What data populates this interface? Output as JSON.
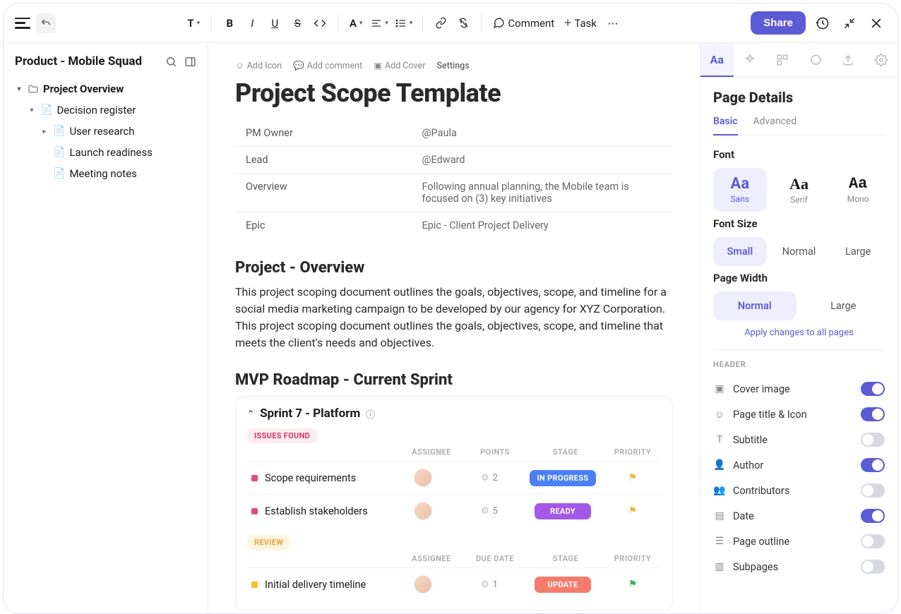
{
  "toolbar": {
    "text_menu": "T",
    "comment": "Comment",
    "task": "Task",
    "share": "Share"
  },
  "sidebar": {
    "title": "Product - Mobile Squad",
    "items": [
      {
        "label": "Project Overview",
        "bold": true
      },
      {
        "label": "Decision register"
      },
      {
        "label": "User research"
      },
      {
        "label": "Launch readiness"
      },
      {
        "label": "Meeting notes"
      }
    ]
  },
  "doc": {
    "meta": {
      "addIcon": "Add Icon",
      "addComment": "Add comment",
      "addCover": "Add Cover",
      "settings": "Settings"
    },
    "title": "Project Scope Template",
    "info": [
      {
        "k": "PM Owner",
        "v": "@Paula"
      },
      {
        "k": "Lead",
        "v": "@Edward"
      },
      {
        "k": "Overview",
        "v": "Following annual planning, the Mobile team is focused on (3) key initiatives"
      },
      {
        "k": "Epic",
        "v": "Epic - Client Project Delivery"
      }
    ],
    "h2a": "Project - Overview",
    "para": "This project scoping document outlines the goals, objectives, scope, and timeline for a social media marketing campaign to be developed by our agency for XYZ Corporation. This project scoping document outlines the goals, objectives, scope, and timeline that meets the client's needs and objectives.",
    "h2b": "MVP Roadmap - Current Sprint",
    "sprint": {
      "title": "Sprint  7 - Platform",
      "group1": {
        "badge": "ISSUES FOUND",
        "cols": [
          "ASSIGNEE",
          "POINTS",
          "STAGE",
          "PRIORITY"
        ],
        "rows": [
          {
            "name": "Scope requirements",
            "points": "2",
            "stage": "IN PROGRESS",
            "stageClass": "blue",
            "flag": "y"
          },
          {
            "name": "Establish stakeholders",
            "points": "5",
            "stage": "READY",
            "stageClass": "purple",
            "flag": "y"
          }
        ]
      },
      "group2": {
        "badge": "REVIEW",
        "cols": [
          "ASSIGNEE",
          "DUE DATE",
          "STAGE",
          "PRIORITY"
        ],
        "rows": [
          {
            "name": "Initial delivery timeline",
            "points": "1",
            "stage": "UPDATE",
            "stageClass": "coral",
            "flag": "g"
          }
        ]
      }
    }
  },
  "panel": {
    "title": "Page Details",
    "subtabs": {
      "basic": "Basic",
      "advanced": "Advanced"
    },
    "font_label": "Font",
    "fonts": [
      {
        "big": "Aa",
        "small": "Sans"
      },
      {
        "big": "Aa",
        "small": "Serif"
      },
      {
        "big": "Aa",
        "small": "Mono"
      }
    ],
    "size_label": "Font Size",
    "sizes": [
      "Small",
      "Normal",
      "Large"
    ],
    "width_label": "Page Width",
    "widths": [
      "Normal",
      "Large"
    ],
    "apply": "Apply changes to all pages",
    "header_label": "HEADER",
    "settings": [
      {
        "label": "Cover image",
        "on": true
      },
      {
        "label": "Page title & Icon",
        "on": true
      },
      {
        "label": "Subtitle",
        "on": false
      },
      {
        "label": "Author",
        "on": true
      },
      {
        "label": "Contributors",
        "on": false
      },
      {
        "label": "Date",
        "on": true
      },
      {
        "label": "Page outline",
        "on": false
      },
      {
        "label": "Subpages",
        "on": false
      }
    ]
  }
}
